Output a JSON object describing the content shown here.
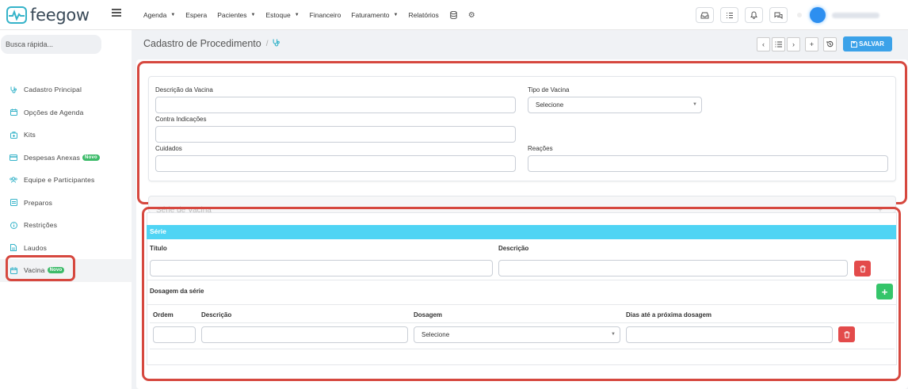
{
  "app": {
    "brand": "feegow"
  },
  "nav": {
    "items": [
      {
        "label": "Agenda",
        "dropdown": true
      },
      {
        "label": "Espera",
        "dropdown": false
      },
      {
        "label": "Pacientes",
        "dropdown": true
      },
      {
        "label": "Estoque",
        "dropdown": true
      },
      {
        "label": "Financeiro",
        "dropdown": false
      },
      {
        "label": "Faturamento",
        "dropdown": true
      },
      {
        "label": "Relatórios",
        "dropdown": false
      }
    ],
    "icons": [
      "database-icon",
      "gear-icon"
    ],
    "actions": [
      "inbox-icon",
      "tasks-icon",
      "bell-icon",
      "chat-icon"
    ]
  },
  "sidebar": {
    "search_placeholder": "Busca rápida...",
    "items": [
      {
        "label": "Cadastro Principal",
        "icon": "stethoscope-icon",
        "badge": ""
      },
      {
        "label": "Opções de Agenda",
        "icon": "calendar-icon",
        "badge": ""
      },
      {
        "label": "Kits",
        "icon": "kit-icon",
        "badge": ""
      },
      {
        "label": "Despesas Anexas",
        "icon": "card-icon",
        "badge": "Novo"
      },
      {
        "label": "Equipe e Participantes",
        "icon": "team-icon",
        "badge": ""
      },
      {
        "label": "Preparos",
        "icon": "list-icon",
        "badge": ""
      },
      {
        "label": "Restrições",
        "icon": "info-icon",
        "badge": ""
      },
      {
        "label": "Laudos",
        "icon": "file-icon",
        "badge": ""
      },
      {
        "label": "Vacina",
        "icon": "calendar-icon",
        "badge": "Novo"
      }
    ]
  },
  "header": {
    "title": "Cadastro de Procedimento",
    "separator": "/",
    "save_label": "SALVAR"
  },
  "form": {
    "descricao_vacina_label": "Descrição da Vacina",
    "descricao_vacina_value": "",
    "tipo_vacina_label": "Tipo de Vacina",
    "tipo_vacina_value": "Selecione",
    "contra_indicacoes_label": "Contra Indicações",
    "contra_indicacoes_value": "",
    "cuidados_label": "Cuidados",
    "cuidados_value": "",
    "reacoes_label": "Reações",
    "reacoes_value": ""
  },
  "serie": {
    "ghost_title": "Série de Vacina",
    "ghost_plus": "+",
    "bar_label": "Série",
    "titulo_label": "Título",
    "titulo_value": "",
    "descricao_label": "Descrição",
    "descricao_value": "",
    "dosagem_header": "Dosagem da série",
    "add_label": "+",
    "cols": {
      "ordem": "Ordem",
      "descricao": "Descrição",
      "dosagem": "Dosagem",
      "dias": "Dias até a próxima dosagem"
    },
    "row": {
      "ordem": "",
      "descricao": "",
      "dosagem": "Selecione",
      "dias": ""
    }
  },
  "colors": {
    "accent": "#35b3c9",
    "save": "#3ba2e9",
    "serie_bar": "#4fd4f4",
    "delete": "#e34b4b",
    "add": "#35c56a",
    "highlight": "#d6483f",
    "badge": "#3dbb6a"
  }
}
